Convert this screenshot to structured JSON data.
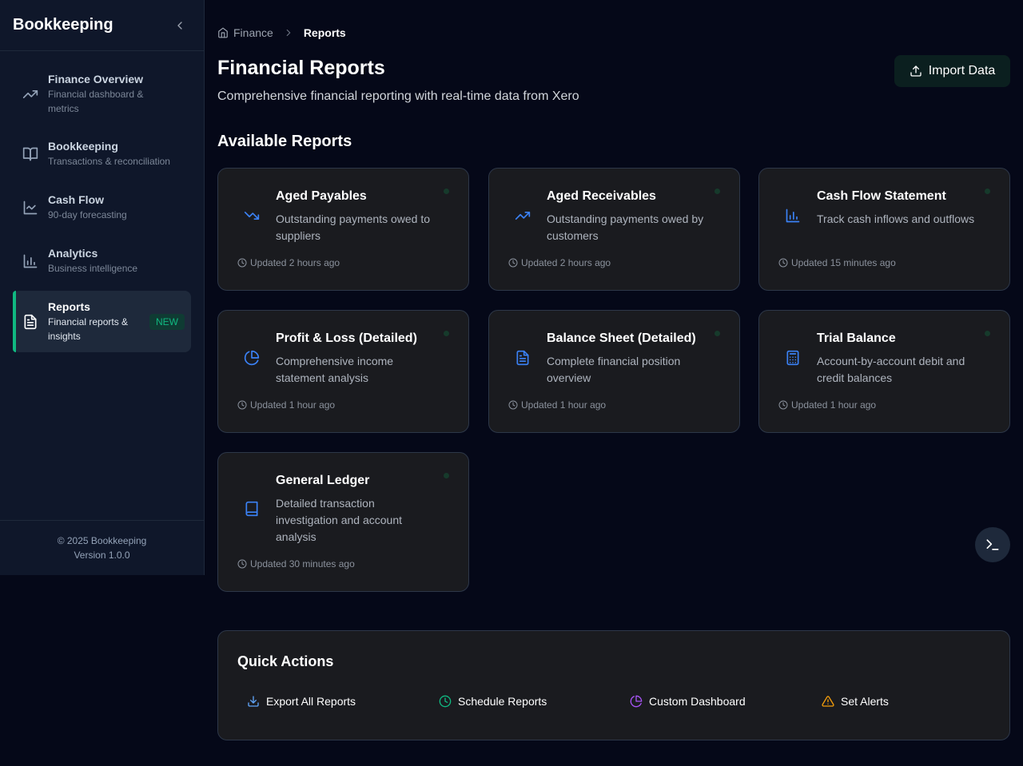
{
  "sidebar": {
    "title": "Bookkeeping",
    "items": [
      {
        "label": "Finance Overview",
        "sub": "Financial dashboard & metrics"
      },
      {
        "label": "Bookkeeping",
        "sub": "Transactions & reconciliation"
      },
      {
        "label": "Cash Flow",
        "sub": "90-day forecasting"
      },
      {
        "label": "Analytics",
        "sub": "Business intelligence"
      },
      {
        "label": "Reports",
        "sub": "Financial reports & insights",
        "badge": "NEW"
      }
    ],
    "footer": {
      "copyright": "© 2025 Bookkeeping",
      "version": "Version 1.0.0"
    }
  },
  "breadcrumb": {
    "parent": "Finance",
    "current": "Reports"
  },
  "header": {
    "title": "Financial Reports",
    "subtitle": "Comprehensive financial reporting with real-time data from Xero",
    "import_label": "Import Data"
  },
  "reports": {
    "section_title": "Available Reports",
    "cards": [
      {
        "title": "Aged Payables",
        "desc": "Outstanding payments owed to suppliers",
        "updated": "Updated 2 hours ago",
        "icon": "trending-down-icon"
      },
      {
        "title": "Aged Receivables",
        "desc": "Outstanding payments owed by customers",
        "updated": "Updated 2 hours ago",
        "icon": "trending-up-icon"
      },
      {
        "title": "Cash Flow Statement",
        "desc": "Track cash inflows and outflows",
        "updated": "Updated 15 minutes ago",
        "icon": "bar-chart-icon"
      },
      {
        "title": "Profit & Loss (Detailed)",
        "desc": "Comprehensive income statement analysis",
        "updated": "Updated 1 hour ago",
        "icon": "pie-chart-icon"
      },
      {
        "title": "Balance Sheet (Detailed)",
        "desc": "Complete financial position overview",
        "updated": "Updated 1 hour ago",
        "icon": "file-text-icon"
      },
      {
        "title": "Trial Balance",
        "desc": "Account-by-account debit and credit balances",
        "updated": "Updated 1 hour ago",
        "icon": "calculator-icon"
      },
      {
        "title": "General Ledger",
        "desc": "Detailed transaction investigation and account analysis",
        "updated": "Updated 30 minutes ago",
        "icon": "book-icon"
      }
    ]
  },
  "quick_actions": {
    "title": "Quick Actions",
    "items": [
      {
        "label": "Export All Reports",
        "color": "#60a5fa"
      },
      {
        "label": "Schedule Reports",
        "color": "#10b981"
      },
      {
        "label": "Custom Dashboard",
        "color": "#a855f7"
      },
      {
        "label": "Set Alerts",
        "color": "#f59e0b"
      }
    ]
  },
  "colors": {
    "accent": "#10b981",
    "icon_blue": "#3b82f6",
    "background": "#050818"
  }
}
